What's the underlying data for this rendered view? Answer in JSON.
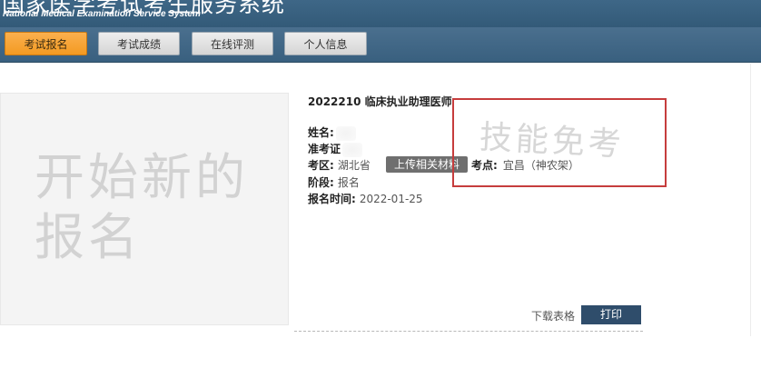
{
  "header": {
    "title_cn": "国家医学考试考生服务系统",
    "title_en": "National Medical Examination Service System"
  },
  "nav": {
    "items": [
      {
        "label": "考试报名",
        "active": true
      },
      {
        "label": "考试成绩",
        "active": false
      },
      {
        "label": "在线评测",
        "active": false
      },
      {
        "label": "个人信息",
        "active": false
      }
    ]
  },
  "left_panel": {
    "placeholder_text": "开始新的报名"
  },
  "registration": {
    "title": "2022210 临床执业助理医师",
    "name_label": "姓名:",
    "ticket_label": "准考证",
    "region_label": "考区:",
    "region_value": "湖北省",
    "upload_button": "上传相关材料",
    "exam_point_label": "考点:",
    "exam_point_value": "宜昌（神农架）",
    "stage_label": "阶段:",
    "stage_value": "报名",
    "time_label": "报名时间:",
    "time_value": "2022-01-25",
    "stamp_text": "技能免考"
  },
  "actions": {
    "download_label": "下载表格",
    "print_label": "打印"
  },
  "colors": {
    "header_bg": "#3e6787",
    "active_tab": "#f39a22",
    "stamp_border": "#c63d3d",
    "print_button": "#2f4d6b"
  }
}
